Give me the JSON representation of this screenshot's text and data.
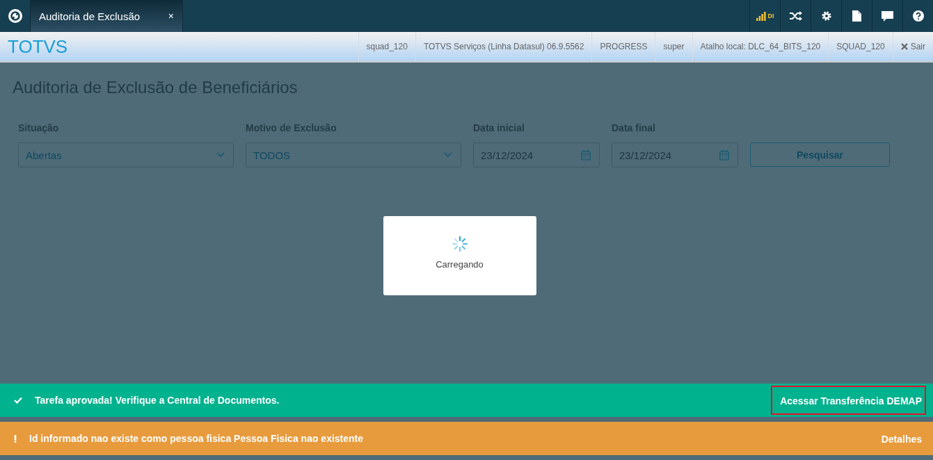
{
  "tabs": [
    {
      "label": "Auditoria de Exclusão",
      "close": "×",
      "selected": true
    }
  ],
  "toolbar": {
    "signal_label": "DI",
    "icons": [
      {
        "kind": "shuffle"
      },
      {
        "kind": "gear"
      },
      {
        "kind": "file"
      },
      {
        "kind": "chat"
      },
      {
        "kind": "help"
      }
    ]
  },
  "header": {
    "logo": "TOTVS",
    "info": [
      "squad_120",
      "TOTVS Serviços (Linha Datasul) 06.9.5562",
      "PROGRESS",
      "super",
      "Atalho local: DLC_64_BITS_120",
      "SQUAD_120"
    ],
    "logout": "Sair"
  },
  "page": {
    "title": "Auditoria de Exclusão de Beneficiários",
    "filters": [
      {
        "kind": "select",
        "label": "Situação",
        "value": "Abertas"
      },
      {
        "kind": "select",
        "label": "Motivo de Exclusão",
        "value": "TODOS"
      },
      {
        "kind": "date",
        "label": "Data inicial",
        "value": "23/12/2024"
      },
      {
        "kind": "date",
        "label": "Data final",
        "value": "23/12/2024"
      }
    ],
    "search_button": "Pesquisar"
  },
  "loading": {
    "text": "Carregando"
  },
  "toasts": [
    {
      "kind": "success",
      "message": "Tarefa aprovada! Verifique a Central de Documentos.",
      "action": "Acessar Transferência DEMAP",
      "highlighted": true
    },
    {
      "kind": "warning",
      "message": "Id informado nao existe como pessoa fisica Pessoa Fisica nao existente",
      "action": "Detalhes",
      "highlighted": false
    }
  ]
}
